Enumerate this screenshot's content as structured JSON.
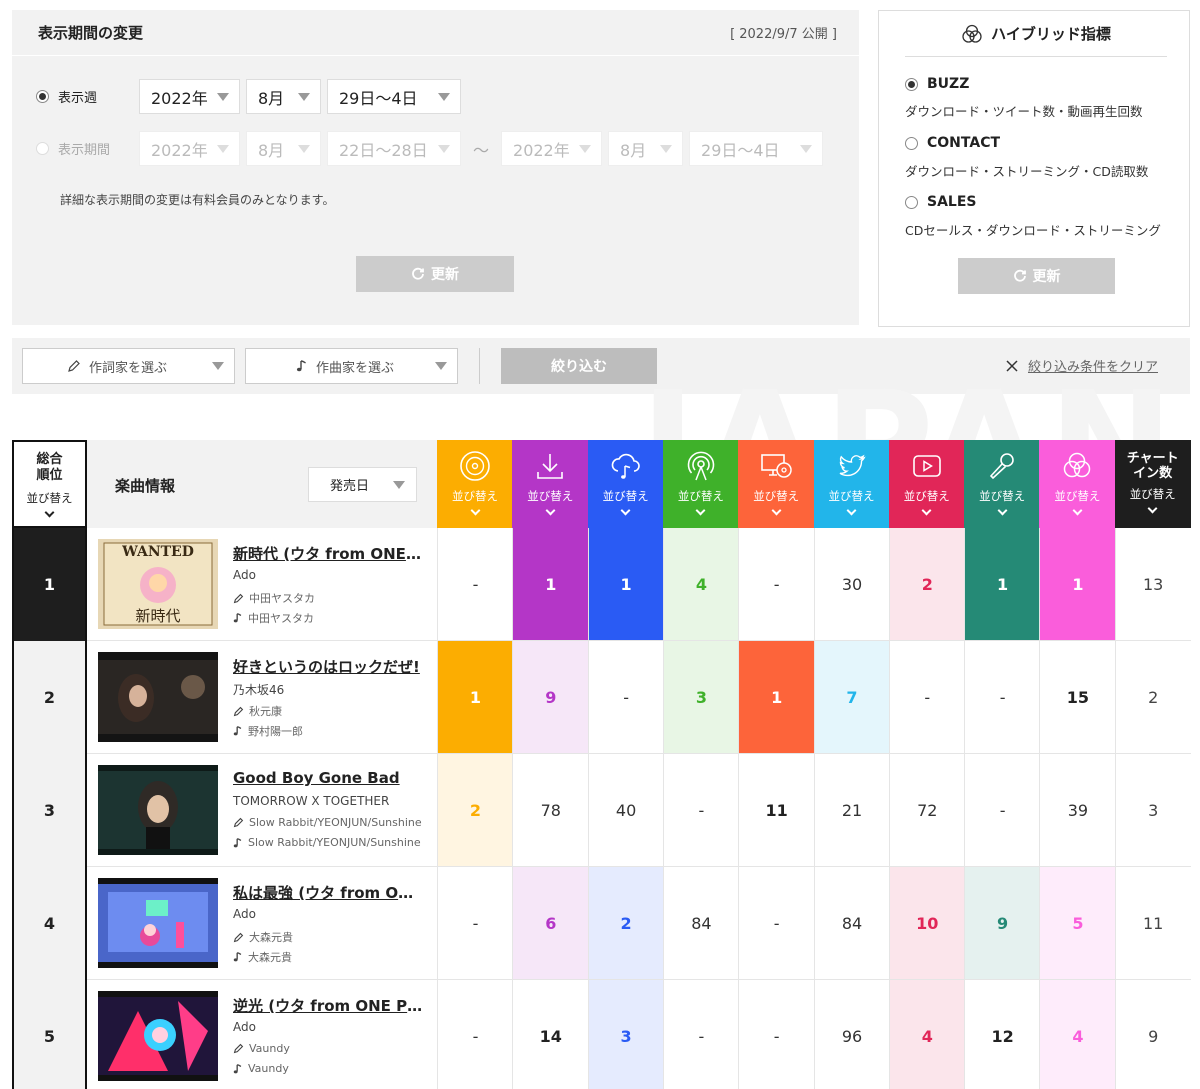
{
  "period": {
    "title": "表示期間の変更",
    "published": "[ 2022/9/7 公開 ]",
    "week_label": "表示週",
    "week_year": "2022年",
    "week_month": "8月",
    "week_days": "29日〜4日",
    "range_label": "表示期間",
    "range_from_year": "2022年",
    "range_from_month": "8月",
    "range_from_days": "22日〜28日",
    "range_sep": "〜",
    "range_to_year": "2022年",
    "range_to_month": "8月",
    "range_to_days": "29日〜4日",
    "note": "詳細な表示期間の変更は有料会員のみとなります。",
    "update_label": "更新"
  },
  "hybrid": {
    "title": "ハイブリッド指標",
    "options": [
      {
        "label": "BUZZ",
        "desc": "ダウンロード・ツイート数・動画再生回数",
        "selected": true
      },
      {
        "label": "CONTACT",
        "desc": "ダウンロード・ストリーミング・CD読取数",
        "selected": false
      },
      {
        "label": "SALES",
        "desc": "CDセールス・ダウンロード・ストリーミング",
        "selected": false
      }
    ],
    "update_label": "更新"
  },
  "filter": {
    "lyricist_placeholder": "作詞家を選ぶ",
    "composer_placeholder": "作曲家を選ぶ",
    "apply_label": "絞り込む",
    "clear_label": "絞り込み条件をクリア"
  },
  "watermark": "JAPAN",
  "table": {
    "rank_header": "総合\n順位",
    "rank_sort": "並び替え",
    "info_header": "楽曲情報",
    "sort_select": "発売日",
    "columns": [
      {
        "icon": "cd-icon",
        "color": "#fcad01",
        "label": "並び替え"
      },
      {
        "icon": "download-icon",
        "color": "#b436c7",
        "label": "並び替え"
      },
      {
        "icon": "streaming-icon",
        "color": "#2a5bf4",
        "label": "並び替え"
      },
      {
        "icon": "radio-icon",
        "color": "#3fb12a",
        "label": "並び替え"
      },
      {
        "icon": "pc-cd-icon",
        "color": "#fd643a",
        "label": "並び替え"
      },
      {
        "icon": "twitter-icon",
        "color": "#22b5ea",
        "label": "並び替え"
      },
      {
        "icon": "video-icon",
        "color": "#e12658",
        "label": "並び替え"
      },
      {
        "icon": "karaoke-icon",
        "color": "#258a76",
        "label": "並び替え"
      },
      {
        "icon": "hybrid-icon",
        "color": "#fa5ddb",
        "label": "並び替え"
      },
      {
        "icon": "",
        "color": "#1e1e1e",
        "label": "並び替え",
        "title": "チャート\nイン数"
      }
    ],
    "rows": [
      {
        "rank": "1",
        "title": "新時代 (ウタ from ONE PIECE FILM RED)",
        "artist": "Ado",
        "lyricist": "中田ヤスタカ",
        "composer": "中田ヤスタカ",
        "values": [
          "-",
          "1",
          "1",
          "4",
          "-",
          "30",
          "2",
          "1",
          "1",
          "13"
        ]
      },
      {
        "rank": "2",
        "title": "好きというのはロックだぜ!",
        "artist": "乃木坂46",
        "lyricist": "秋元康",
        "composer": "野村陽一郎",
        "values": [
          "1",
          "9",
          "-",
          "3",
          "1",
          "7",
          "-",
          "-",
          "15",
          "2"
        ]
      },
      {
        "rank": "3",
        "title": "Good Boy Gone Bad",
        "artist": "TOMORROW X TOGETHER",
        "lyricist": "Slow Rabbit/YEONJUN/Sunshine",
        "composer": "Slow Rabbit/YEONJUN/Sunshine",
        "values": [
          "2",
          "78",
          "40",
          "-",
          "11",
          "21",
          "72",
          "-",
          "39",
          "3"
        ]
      },
      {
        "rank": "4",
        "title": "私は最強 (ウタ from ONE PIECE FILM RED)",
        "artist": "Ado",
        "lyricist": "大森元貴",
        "composer": "大森元貴",
        "values": [
          "-",
          "6",
          "2",
          "84",
          "-",
          "84",
          "10",
          "9",
          "5",
          "11"
        ]
      },
      {
        "rank": "5",
        "title": "逆光 (ウタ from ONE PIECE FILM RED)",
        "artist": "Ado",
        "lyricist": "Vaundy",
        "composer": "Vaundy",
        "values": [
          "-",
          "14",
          "3",
          "-",
          "-",
          "96",
          "4",
          "12",
          "4",
          "9"
        ]
      }
    ]
  }
}
